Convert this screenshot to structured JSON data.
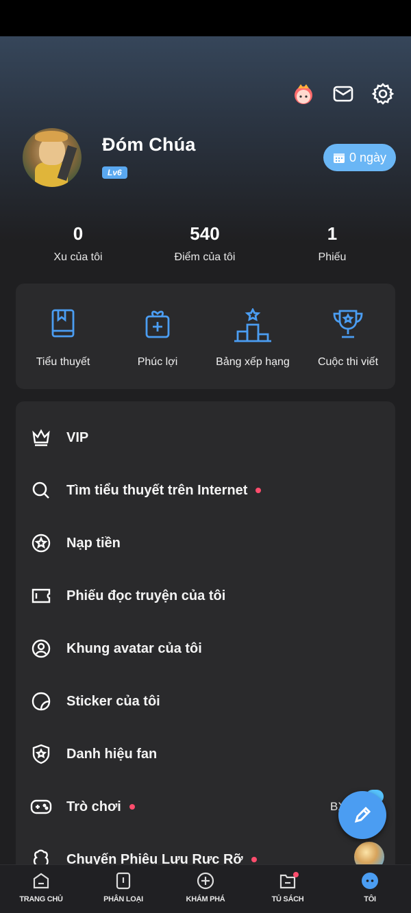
{
  "profile": {
    "name": "Đóm Chúa",
    "level": "Lv6",
    "days_label": "0 ngày"
  },
  "stats": [
    {
      "value": "0",
      "label": "Xu của tôi"
    },
    {
      "value": "540",
      "label": "Điểm của tôi"
    },
    {
      "value": "1",
      "label": "Phiếu"
    }
  ],
  "features": [
    {
      "label": "Tiểu thuyết",
      "icon": "book-icon"
    },
    {
      "label": "Phúc lợi",
      "icon": "gift-icon"
    },
    {
      "label": "Bảng xếp hạng",
      "icon": "podium-icon"
    },
    {
      "label": "Cuộc thi viết",
      "icon": "trophy-icon"
    }
  ],
  "menu": [
    {
      "label": "VIP",
      "icon": "crown-icon",
      "dot": false
    },
    {
      "label": "Tìm tiểu thuyết trên Internet",
      "icon": "search-icon",
      "dot": true
    },
    {
      "label": "Nạp tiền",
      "icon": "star-circle-icon",
      "dot": false
    },
    {
      "label": "Phiếu đọc truyện của tôi",
      "icon": "ticket-icon",
      "dot": false
    },
    {
      "label": "Khung avatar của tôi",
      "icon": "avatar-frame-icon",
      "dot": false
    },
    {
      "label": "Sticker của tôi",
      "icon": "sticker-icon",
      "dot": false
    },
    {
      "label": "Danh hiệu fan",
      "icon": "shield-star-icon",
      "dot": false
    },
    {
      "label": "Trò chơi",
      "icon": "gamepad-icon",
      "dot": true,
      "right": "BXH"
    },
    {
      "label": "Chuyến Phiêu Lưu Rực Rỡ",
      "icon": "adventure-icon",
      "dot": true
    }
  ],
  "nav": [
    {
      "label": "TRANG CHỦ",
      "icon": "home-icon"
    },
    {
      "label": "PHÂN LOẠI",
      "icon": "category-icon"
    },
    {
      "label": "KHÁM PHÁ",
      "icon": "explore-icon"
    },
    {
      "label": "TỦ SÁCH",
      "icon": "bookshelf-icon"
    },
    {
      "label": "TÔI",
      "icon": "me-icon"
    }
  ],
  "colors": {
    "accent": "#4b9df2",
    "dot": "#ff4d6d",
    "card": "#2a2a2c",
    "background": "#1f1f21"
  }
}
